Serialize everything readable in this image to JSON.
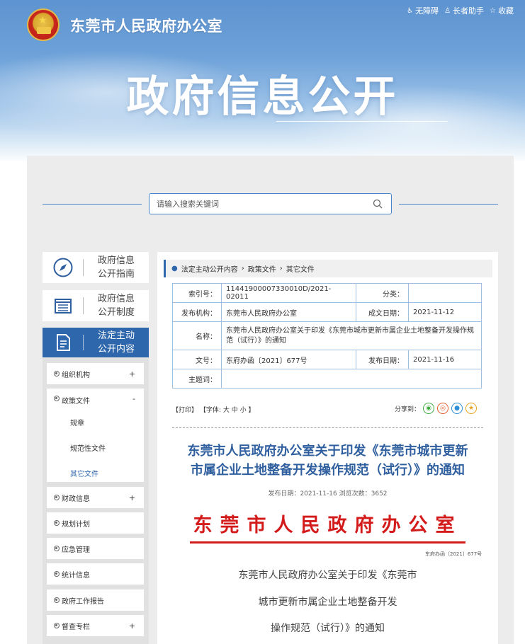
{
  "header": {
    "site_title": "东莞市人民政府办公室",
    "big_title": "政府信息公开",
    "links": [
      {
        "icon": "accessibility-icon",
        "label": "无障碍"
      },
      {
        "icon": "elder-icon",
        "label": "长者助手"
      },
      {
        "icon": "star-icon",
        "label": "收藏"
      }
    ]
  },
  "search": {
    "placeholder": "请输入搜索关键词"
  },
  "sidebar": {
    "cards": [
      {
        "icon": "compass-icon",
        "label_line1": "政府信息",
        "label_line2": "公开指南"
      },
      {
        "icon": "list-doc-icon",
        "label_line1": "政府信息",
        "label_line2": "公开制度"
      },
      {
        "icon": "document-icon",
        "label_line1": "法定主动",
        "label_line2": "公开内容"
      }
    ],
    "nav": [
      {
        "label": "组织机构",
        "toggle": "+"
      },
      {
        "label": "政策文件",
        "toggle": "-"
      },
      {
        "label": "财政信息",
        "toggle": "+"
      },
      {
        "label": "规划计划",
        "toggle": ""
      },
      {
        "label": "应急管理",
        "toggle": ""
      },
      {
        "label": "统计信息",
        "toggle": ""
      },
      {
        "label": "政府工作报告",
        "toggle": ""
      },
      {
        "label": "督查专栏",
        "toggle": "+"
      }
    ],
    "sub_items": [
      "规章",
      "规范性文件",
      "其它文件"
    ]
  },
  "breadcrumb": [
    "法定主动公开内容",
    "政策文件",
    "其它文件"
  ],
  "meta": {
    "index_label": "索引号：",
    "index_value": "11441900007330010D/2021-02011",
    "category_label": "分类：",
    "category_value": "",
    "org_label": "发布机构：",
    "org_value": "东莞市人民政府办公室",
    "date_made_label": "成文日期：",
    "date_made_value": "2021-11-12",
    "name_label": "名称：",
    "name_value": "东莞市人民政府办公室关于印发《东莞市城市更新市属企业土地整备开发操作规范（试行）》的通知",
    "doc_no_label": "文号：",
    "doc_no_value": "东府办函〔2021〕677号",
    "pub_date_label": "发布日期：",
    "pub_date_value": "2021-11-16",
    "subject_label": "主题词：",
    "subject_value": ""
  },
  "tools": {
    "print": "【打印】",
    "font_prefix": "【字体:",
    "font_large": "大",
    "font_medium": "中",
    "font_small": "小",
    "font_suffix": "】",
    "share_label": "分享到："
  },
  "document": {
    "title_line1": "东莞市人民政府办公室关于印发《东莞市城市更新",
    "title_line2": "市属企业土地整备开发操作规范（试行）》的通知",
    "info": "发布日期：2021-11-16  浏览次数：3652",
    "red_header": "东莞市人民政府办公室",
    "doc_number": "东府办函〔2021〕677号",
    "body_lines": [
      "东莞市人民政府办公室关于印发《东莞市",
      "城市更新市属企业土地整备开发",
      "操作规范（试行）》的通知"
    ]
  },
  "colors": {
    "accent": "#2f67ac",
    "red": "#d41b1b",
    "title_blue": "#2f5f9e"
  }
}
